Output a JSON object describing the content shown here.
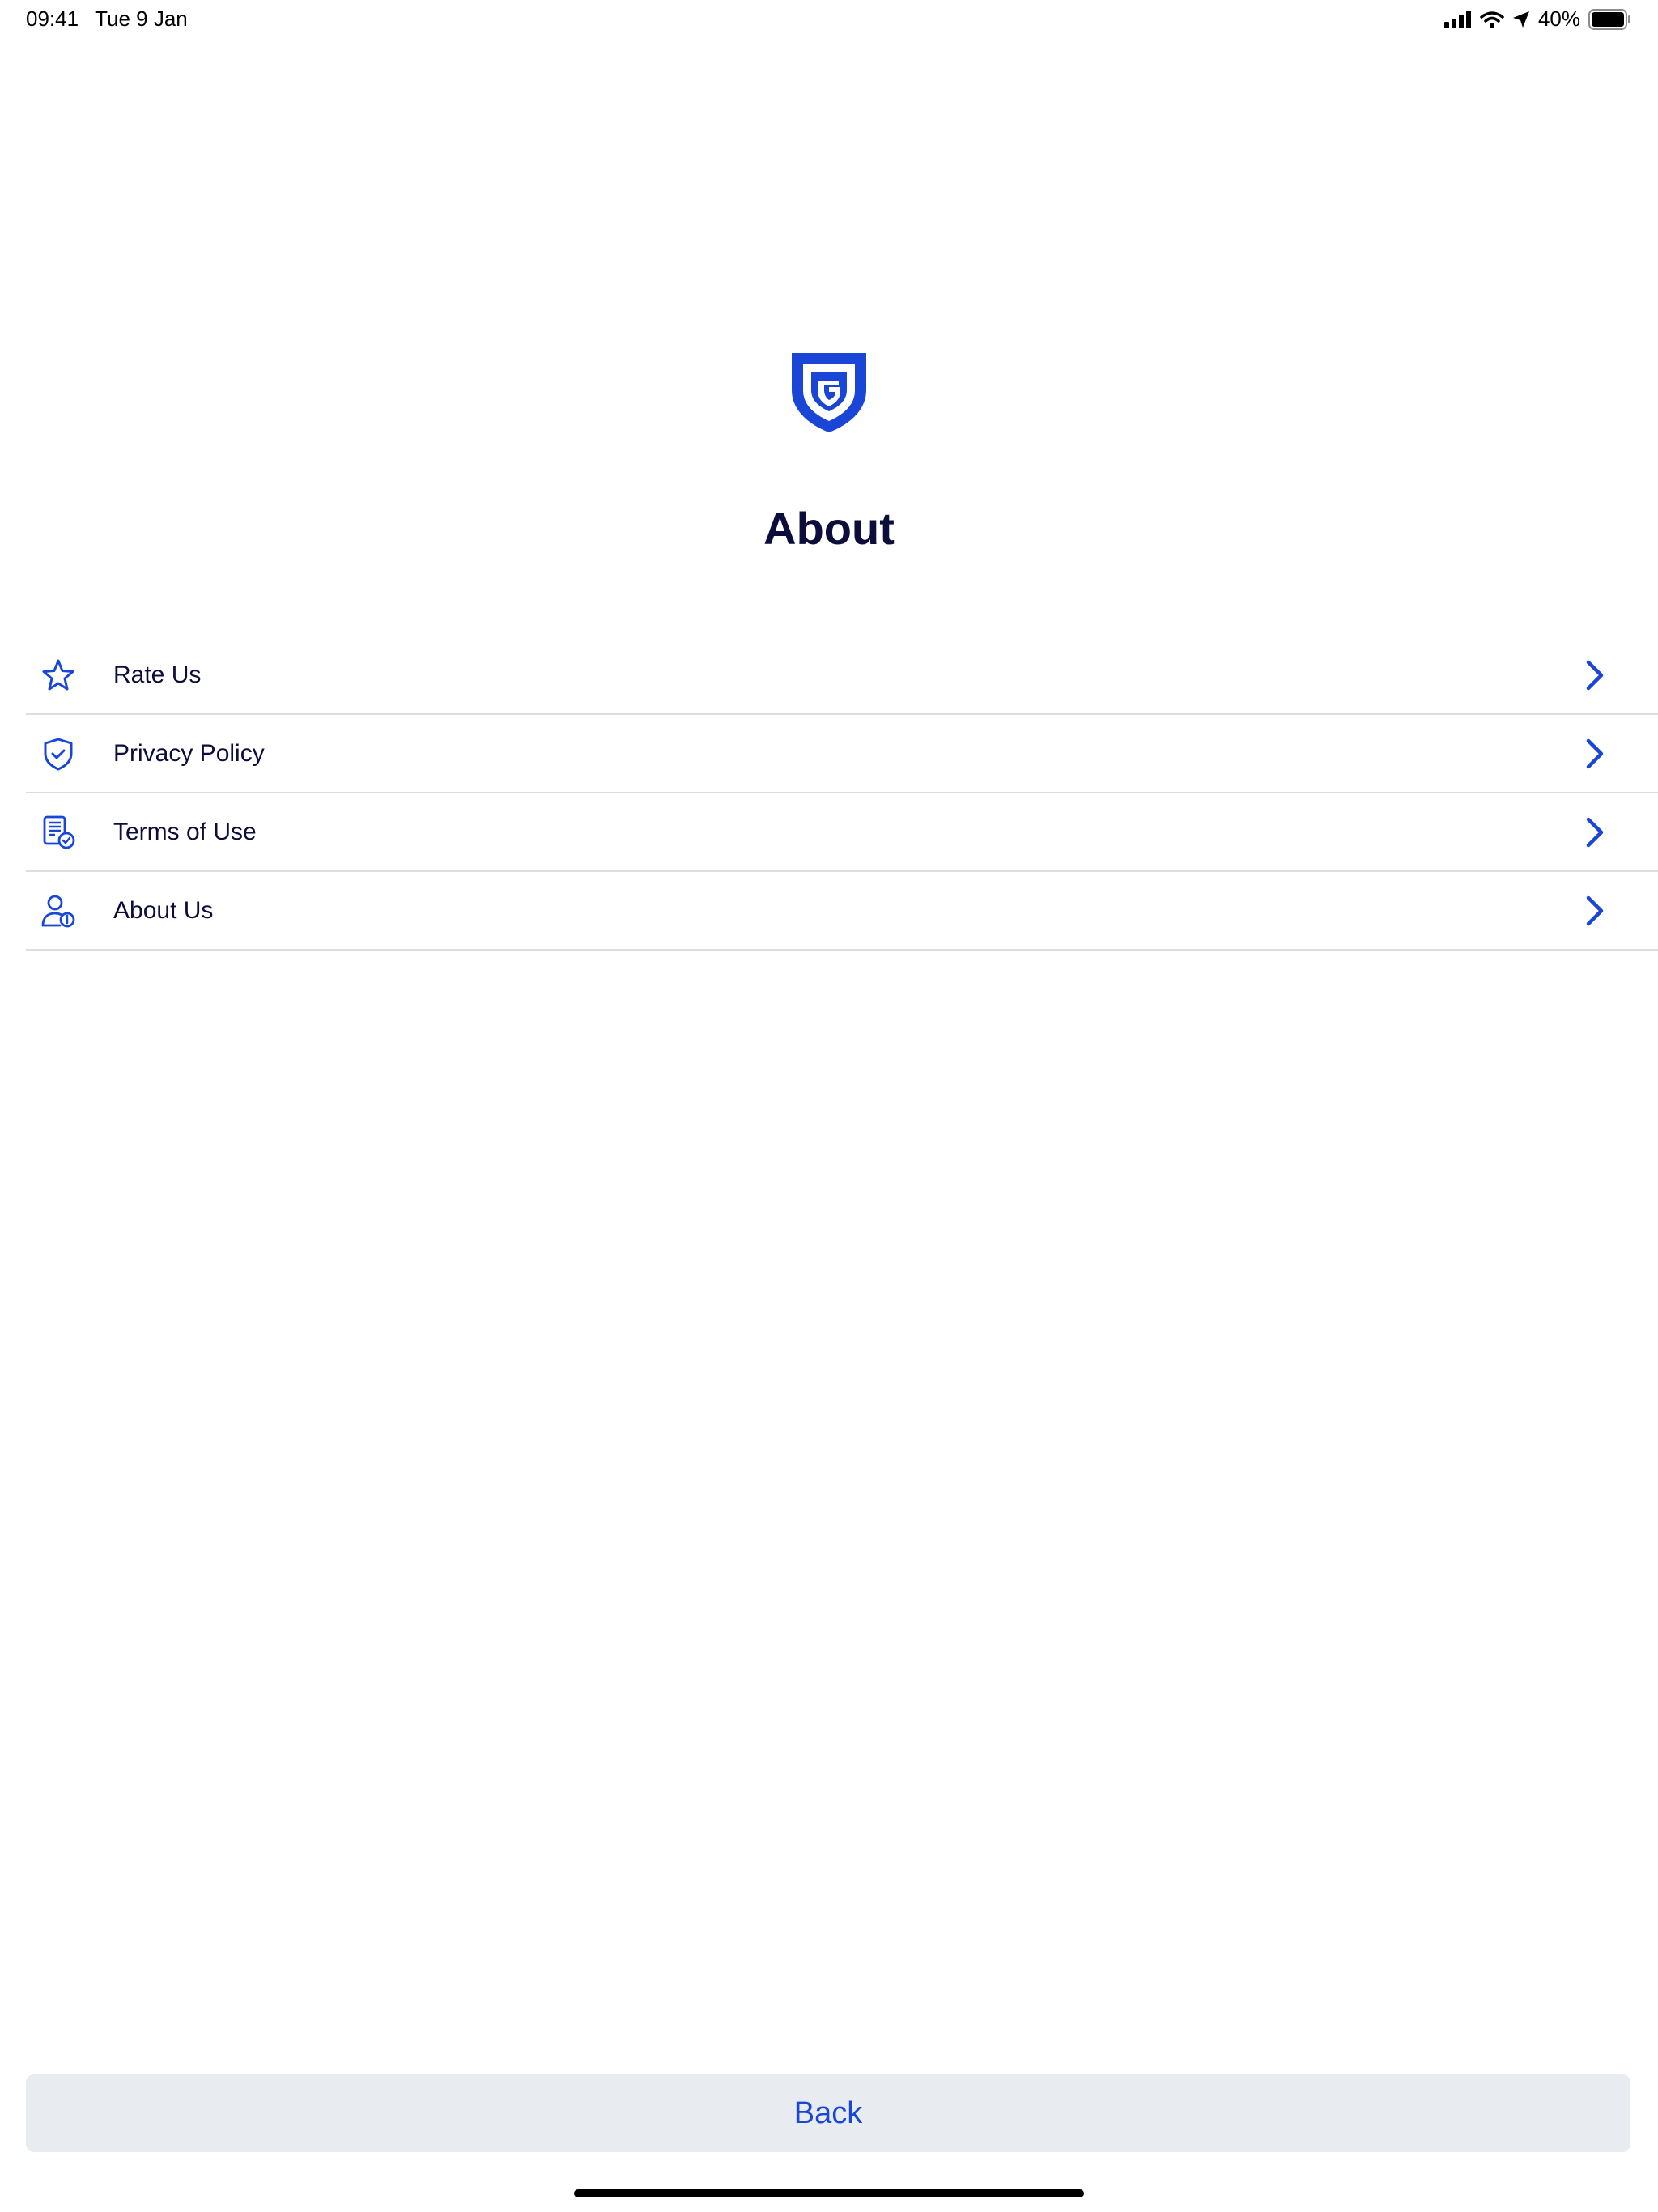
{
  "status_bar": {
    "time": "09:41",
    "date": "Tue 9 Jan",
    "battery": "40%",
    "battery_level": 0.4
  },
  "header": {
    "logo_icon": "shield-g-logo-icon",
    "title": "About"
  },
  "menu": {
    "items": [
      {
        "label": "Rate Us",
        "icon": "star-icon"
      },
      {
        "label": "Privacy Policy",
        "icon": "shield-check-icon"
      },
      {
        "label": "Terms of Use",
        "icon": "document-check-icon"
      },
      {
        "label": "About Us",
        "icon": "user-info-icon"
      }
    ]
  },
  "footer": {
    "back_label": "Back"
  },
  "colors": {
    "accent": "#1946d6",
    "text": "#0d0d3b",
    "divider": "#dcdde0",
    "button_bg": "#e8ebef"
  }
}
